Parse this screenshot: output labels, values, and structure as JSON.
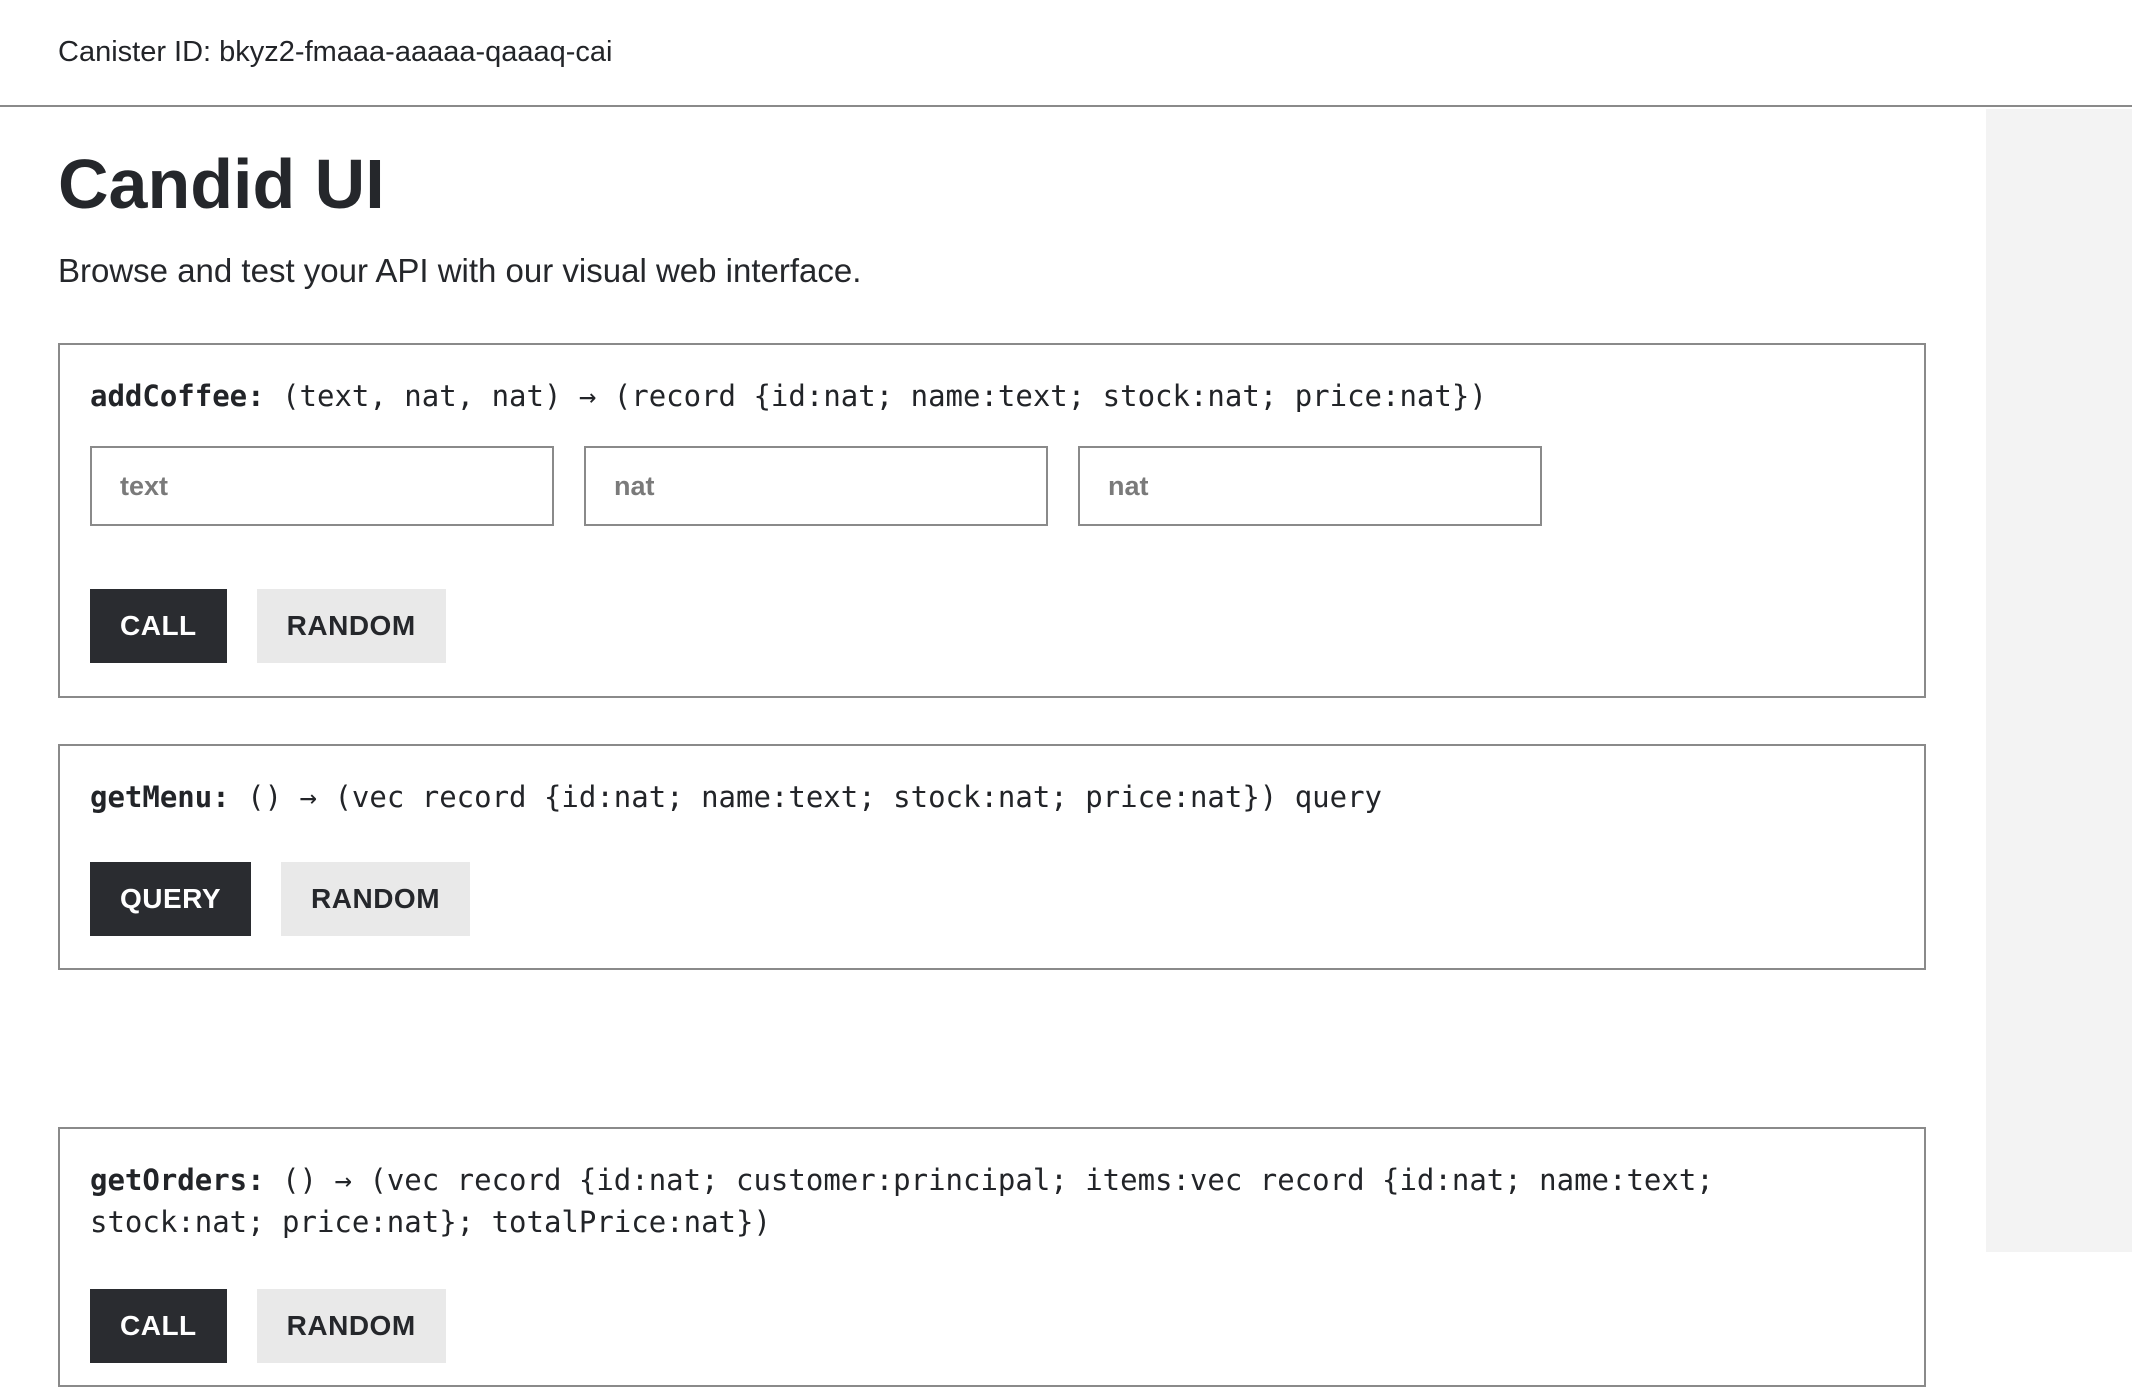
{
  "header": {
    "canister_label": "Canister ID: bkyz2-fmaaa-aaaaa-qaaaq-cai"
  },
  "page": {
    "title": "Candid UI",
    "subtitle": "Browse and test your API with our visual web interface."
  },
  "methods": [
    {
      "name": "addCoffee:",
      "signature": " (text, nat, nat) → (record {id:nat; name:text; stock:nat; price:nat})",
      "inputs": [
        {
          "placeholder": "text"
        },
        {
          "placeholder": "nat"
        },
        {
          "placeholder": "nat"
        }
      ],
      "primary_label": "CALL",
      "random_label": "RANDOM"
    },
    {
      "name": "getMenu:",
      "signature": " () → (vec record {id:nat; name:text; stock:nat; price:nat}) query",
      "primary_label": "QUERY",
      "random_label": "RANDOM"
    },
    {
      "name": "getOrders:",
      "signature": " () → (vec record {id:nat; customer:principal; items:vec record {id:nat; name:text; stock:nat; price:nat}; totalPrice:nat})",
      "primary_label": "CALL",
      "random_label": "RANDOM"
    }
  ]
}
